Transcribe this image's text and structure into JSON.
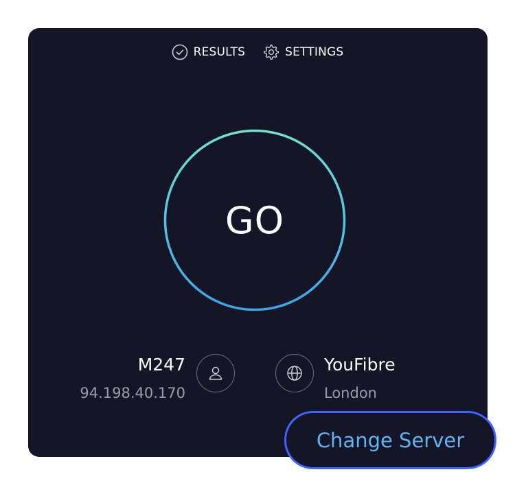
{
  "nav": {
    "results_label": "RESULTS",
    "settings_label": "SETTINGS"
  },
  "go_button": {
    "label": "GO"
  },
  "provider": {
    "name": "M247",
    "ip": "94.198.40.170"
  },
  "server": {
    "name": "YouFibre",
    "location": "London"
  },
  "change_server": {
    "label": "Change Server"
  },
  "icons": {
    "results": "check-circle-icon",
    "settings": "gear-icon",
    "user": "user-icon",
    "globe": "globe-icon"
  },
  "colors": {
    "card_bg": "#141526",
    "ring_start": "#6fe3d4",
    "ring_end": "#3aa6e8",
    "focus_border": "#3f63ff",
    "link_text": "#5fb3f2"
  }
}
